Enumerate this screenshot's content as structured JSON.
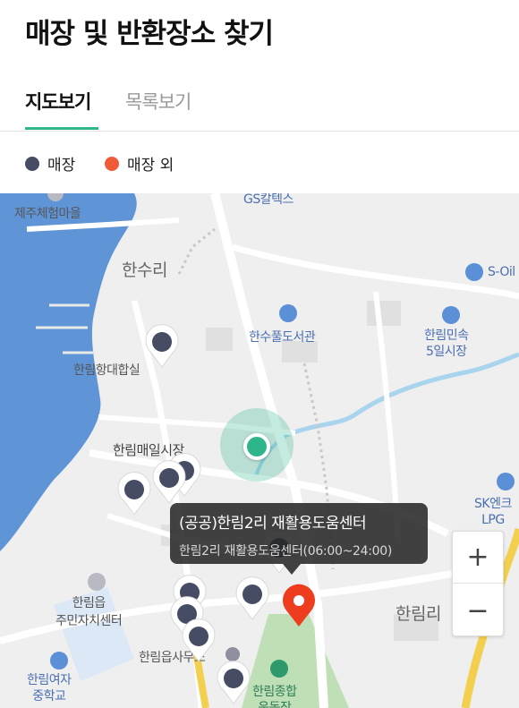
{
  "page": {
    "title": "매장 및 반환장소 찾기"
  },
  "tabs": [
    {
      "label": "지도보기",
      "active": true
    },
    {
      "label": "목록보기",
      "active": false
    }
  ],
  "legend": {
    "store": {
      "label": "매장",
      "color": "#454c63"
    },
    "other": {
      "label": "매장 외",
      "color": "#f05a38"
    }
  },
  "map": {
    "labels": {
      "jeju_village": "제주체험마을",
      "gs": "GS칼텍스",
      "hansu": "한수리",
      "s_oil": "S-Oil",
      "library": "한수풀도서관",
      "market5": "한림민속\n5일시장",
      "port": "한림항대합실",
      "daily_market": "한림매일시장",
      "sk_lpg": "SK엔크\nLPG",
      "community": "한림읍\n주민자치센터",
      "hallim_ri": "한림리",
      "office": "한림읍사무소",
      "girls_school": "한림여자\n중학교",
      "sports": "한림종합\n운동장"
    },
    "tooltip": {
      "title": "(공공)한림2리 재활용도움센터",
      "subtitle": "한림2리 재활용도움센터(06:00~24:00)"
    },
    "zoom": {
      "in": "+",
      "out": "−"
    }
  }
}
